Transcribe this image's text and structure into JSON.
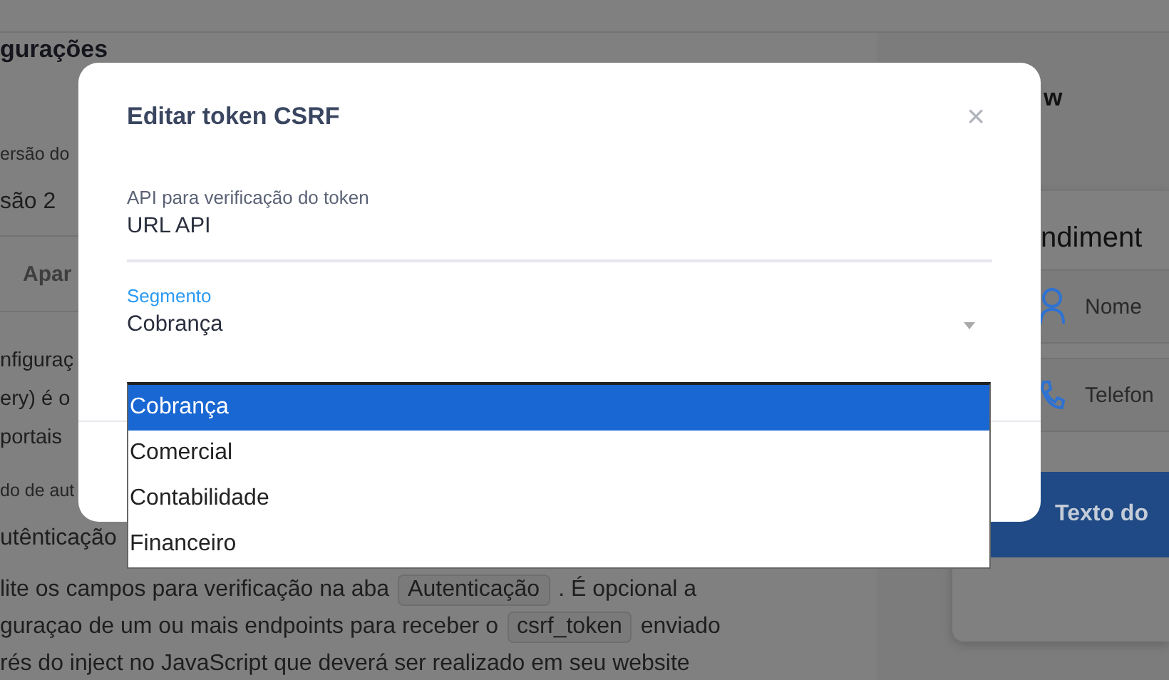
{
  "background": {
    "heading": "gurações",
    "version_label": "ersão do",
    "version_value": "são 2",
    "tab": "Apar",
    "intro_lines": [
      "nfiguraç",
      "ery) é o",
      "portais"
    ],
    "auth_label": "do de aut",
    "auth_value": "utênticação",
    "help_lines": [
      {
        "parts": [
          {
            "kind": "text",
            "text": "lite os campos para verificação na aba"
          },
          {
            "kind": "code",
            "text": "Autenticação"
          },
          {
            "kind": "text",
            "text": ". É opcional a"
          }
        ]
      },
      {
        "parts": [
          {
            "kind": "text",
            "text": "guraçao de um ou mais endpoints para receber o"
          },
          {
            "kind": "code",
            "text": "csrf_token"
          },
          {
            "kind": "text",
            "text": "enviado"
          }
        ]
      },
      {
        "parts": [
          {
            "kind": "text",
            "text": "rés do inject no JavaScript que deverá ser realizado em seu website"
          }
        ]
      }
    ],
    "preview_title": "w",
    "card_title": "ndiment",
    "fields": [
      {
        "kind": "person",
        "placeholder": "Nome"
      },
      {
        "kind": "phone",
        "placeholder": "Telefon"
      }
    ],
    "card_button": "Texto do"
  },
  "dialog": {
    "title": "Editar token CSRF",
    "close": "×",
    "fields": [
      {
        "label": "API para verificação do token",
        "value": "URL API",
        "focused": false
      },
      {
        "label": "Segmento",
        "value": "Cobrança",
        "focused": true
      }
    ],
    "options": [
      {
        "label": "Cobrança",
        "selected": true
      },
      {
        "label": "Comercial",
        "selected": false
      },
      {
        "label": "Contabilidade",
        "selected": false
      },
      {
        "label": "Financeiro",
        "selected": false
      }
    ]
  }
}
